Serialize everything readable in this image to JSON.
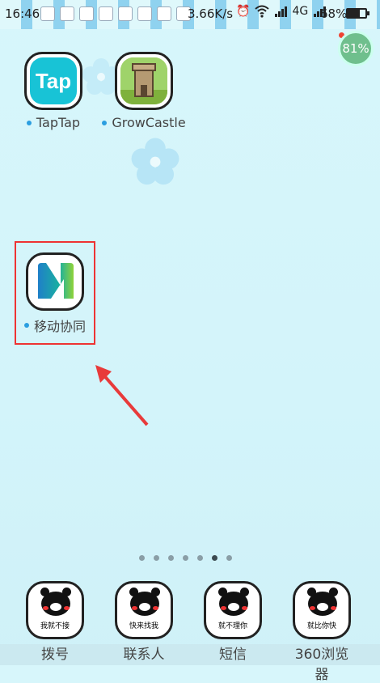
{
  "status_bar": {
    "time": "16:46",
    "network_speed": "3.66K/s",
    "network_type": "4G",
    "battery_percent": "68%",
    "battery_level": 0.68
  },
  "memory_ball": {
    "value": "81%"
  },
  "apps": [
    {
      "name": "TapTap",
      "icon_text": "Tap",
      "icon": "taptap-icon"
    },
    {
      "name": "GrowCastle",
      "icon": "castle-icon"
    },
    {
      "name": "移动协同",
      "icon": "m-logo-icon"
    }
  ],
  "page_indicator": {
    "count": 7,
    "active": 6
  },
  "dock": [
    {
      "label": "拨号",
      "caption": "我就不接"
    },
    {
      "label": "联系人",
      "caption": "快来找我"
    },
    {
      "label": "短信",
      "caption": "就不理你"
    },
    {
      "label": "360浏览器",
      "caption": "就比你快"
    }
  ],
  "colors": {
    "highlight": "#e33333",
    "arrow": "#e83a3a",
    "background": "#d7f6fb"
  }
}
